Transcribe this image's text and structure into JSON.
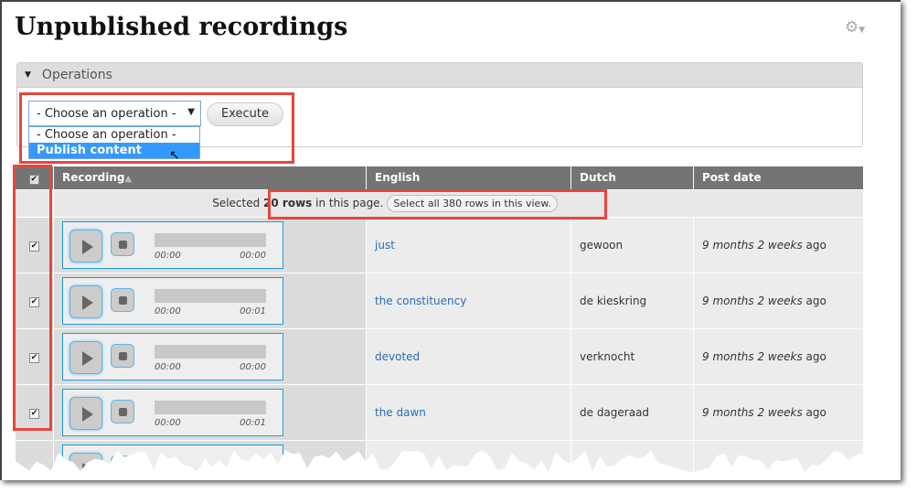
{
  "page": {
    "title": "Unpublished recordings"
  },
  "operations": {
    "legend": "Operations",
    "select_value": "- Choose an operation -",
    "options": [
      "- Choose an operation -",
      "Publish content"
    ],
    "execute_label": "Execute"
  },
  "table": {
    "headers": {
      "recording": "Recording",
      "english": "English",
      "dutch": "Dutch",
      "post_date": "Post date"
    },
    "selection": {
      "prefix": "Selected ",
      "count": "20 rows",
      "suffix": " in this page.",
      "select_all_label": "Select all 380 rows in this view."
    },
    "rows": [
      {
        "checked": true,
        "start": "00:00",
        "end": "00:00",
        "english": "just",
        "dutch": "gewoon",
        "date_em": "9 months 2 weeks",
        "date_ago": " ago"
      },
      {
        "checked": true,
        "start": "00:00",
        "end": "00:01",
        "english": "the constituency",
        "dutch": "de kieskring",
        "date_em": "9 months 2 weeks",
        "date_ago": " ago"
      },
      {
        "checked": true,
        "start": "00:00",
        "end": "00:00",
        "english": "devoted",
        "dutch": "verknocht",
        "date_em": "9 months 2 weeks",
        "date_ago": " ago"
      },
      {
        "checked": true,
        "start": "00:00",
        "end": "00:01",
        "english": "the dawn",
        "dutch": "de dageraad",
        "date_em": "9 months 2 weeks",
        "date_ago": " ago"
      }
    ]
  },
  "colors": {
    "highlight_box": "#e8453c",
    "header_bg": "#747474",
    "link": "#2a6db0",
    "option_selected": "#3399ff"
  }
}
